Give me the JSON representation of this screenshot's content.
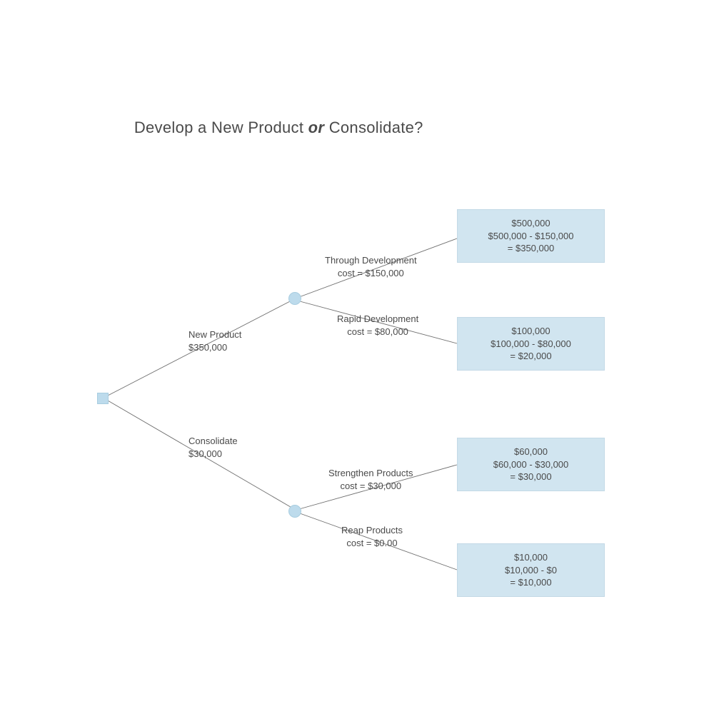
{
  "title_pre": "Develop a New Product ",
  "title_em": "or",
  "title_post": " Consolidate?",
  "branch_new_product": "New Product\n$350,000",
  "branch_consolidate": "Consolidate\n$30,000",
  "opt_through_dev": "Through Development\ncost = $150,000",
  "opt_rapid_dev": "Rapid Development\ncost = $80,000",
  "opt_strengthen": "Strengthen Products\ncost = $30,000",
  "opt_reap": "Reap Products\ncost = $0.00",
  "out1": "$500,000\n$500,000 - $150,000\n= $350,000",
  "out2": "$100,000\n$100,000 - $80,000\n= $20,000",
  "out3": "$60,000\n$60,000 - $30,000\n= $30,000",
  "out4": "$10,000\n$10,000 - $0\n= $10,000"
}
